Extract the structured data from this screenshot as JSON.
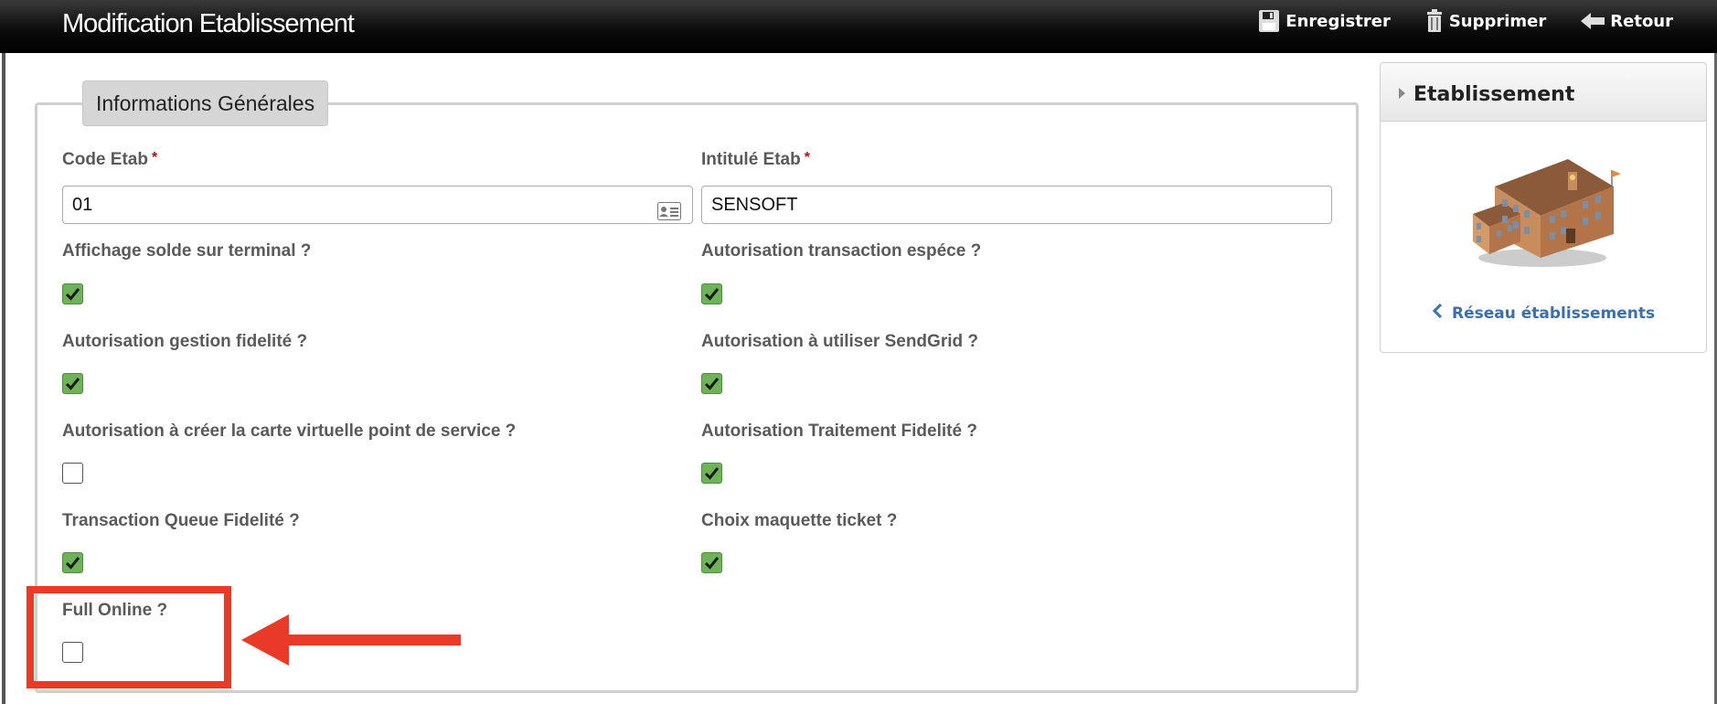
{
  "header": {
    "title": "Modification Etablissement",
    "actions": [
      {
        "label": "Enregistrer",
        "icon": "save-icon"
      },
      {
        "label": "Supprimer",
        "icon": "trash-icon"
      },
      {
        "label": "Retour",
        "icon": "back-arrow-icon"
      }
    ]
  },
  "form": {
    "legend": "Informations Générales",
    "code_etab": {
      "label": "Code Etab",
      "required_mark": "*",
      "value": "01"
    },
    "intitule_etab": {
      "label": "Intitulé Etab",
      "required_mark": "*",
      "value": "SENSOFT"
    },
    "checkboxes": [
      {
        "label": "Affichage solde sur terminal ?",
        "checked": true
      },
      {
        "label": "Autorisation transaction espéce ?",
        "checked": true
      },
      {
        "label": "Autorisation gestion fidelité ?",
        "checked": true
      },
      {
        "label": "Autorisation à utiliser SendGrid ?",
        "checked": true
      },
      {
        "label": "Autorisation à créer la carte virtuelle point de service ?",
        "checked": false
      },
      {
        "label": "Autorisation Traitement Fidelité ?",
        "checked": true
      },
      {
        "label": "Transaction Queue Fidelité ?",
        "checked": true
      },
      {
        "label": "Choix maquette ticket ?",
        "checked": true
      },
      {
        "label": "Full Online ?",
        "checked": false
      }
    ]
  },
  "panel": {
    "title": "Etablissement",
    "link": "Réseau établissements"
  },
  "colors": {
    "check_green": "#6eb358",
    "annotation_red": "#e83a26",
    "link_blue": "#3a6fb0"
  }
}
